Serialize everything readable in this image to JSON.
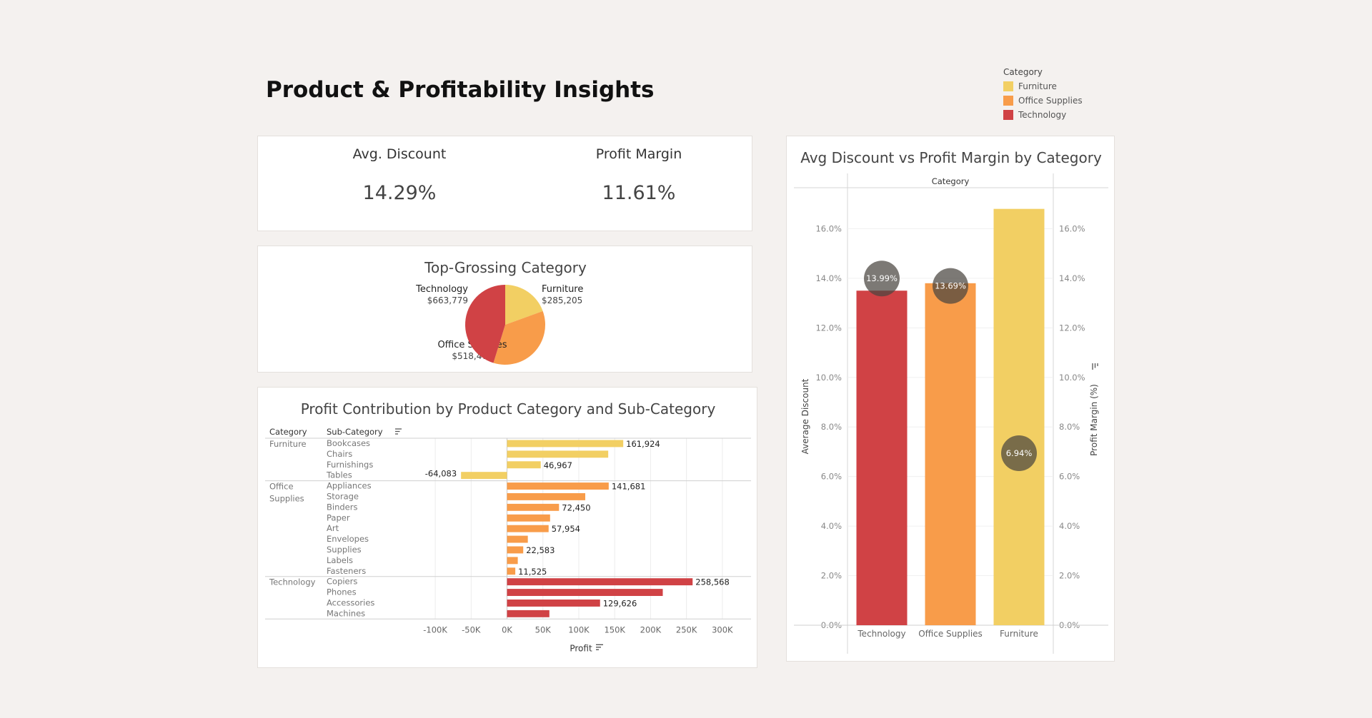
{
  "dashboard": {
    "title": "Product & Profitability Insights"
  },
  "colors": {
    "furniture": "#f2cf63",
    "office_supplies": "#f89c4a",
    "technology": "#d04245",
    "circle": "#5c5550"
  },
  "legend": {
    "title": "Category",
    "items": [
      {
        "label": "Furniture",
        "color": "#f2cf63"
      },
      {
        "label": "Office Supplies",
        "color": "#f89c4a"
      },
      {
        "label": "Technology",
        "color": "#d04245"
      }
    ]
  },
  "kpis": [
    {
      "label": "Avg. Discount",
      "value": "14.29%"
    },
    {
      "label": "Profit Margin",
      "value": "11.61%"
    }
  ],
  "chart_data": [
    {
      "type": "pie",
      "title": "Top-Grossing Category",
      "slices": [
        {
          "label": "Furniture",
          "value": 285205,
          "value_label": "$285,205",
          "color": "#f2cf63"
        },
        {
          "label": "Office Supplies",
          "value": 518474,
          "value_label": "$518,474",
          "color": "#f89c4a"
        },
        {
          "label": "Technology",
          "value": 663779,
          "value_label": "$663,779",
          "color": "#d04245"
        }
      ]
    },
    {
      "type": "bar",
      "orientation": "horizontal",
      "title": "Profit Contribution by Product Category and Sub-Category",
      "row_headers": [
        "Category",
        "Sub-Category"
      ],
      "xlabel": "Profit",
      "xlim": [
        -120000,
        330000
      ],
      "xticks": [
        -100000,
        -50000,
        0,
        50000,
        100000,
        150000,
        200000,
        250000,
        300000
      ],
      "xtick_labels": [
        "-100K",
        "-50K",
        "0K",
        "50K",
        "100K",
        "150K",
        "200K",
        "250K",
        "300K"
      ],
      "groups": [
        {
          "category": "Furniture",
          "color": "#f2cf63",
          "rows": [
            {
              "name": "Bookcases",
              "value": 161924,
              "label": "161,924"
            },
            {
              "name": "Chairs",
              "value": 141000,
              "label": ""
            },
            {
              "name": "Furnishings",
              "value": 46967,
              "label": "46,967"
            },
            {
              "name": "Tables",
              "value": -64083,
              "label": "-64,083"
            }
          ]
        },
        {
          "category": "Office Supplies",
          "color": "#f89c4a",
          "rows": [
            {
              "name": "Appliances",
              "value": 141681,
              "label": "141,681"
            },
            {
              "name": "Storage",
              "value": 109000,
              "label": ""
            },
            {
              "name": "Binders",
              "value": 72450,
              "label": "72,450"
            },
            {
              "name": "Paper",
              "value": 60000,
              "label": ""
            },
            {
              "name": "Art",
              "value": 57954,
              "label": "57,954"
            },
            {
              "name": "Envelopes",
              "value": 29000,
              "label": ""
            },
            {
              "name": "Supplies",
              "value": 22583,
              "label": "22,583"
            },
            {
              "name": "Labels",
              "value": 15000,
              "label": ""
            },
            {
              "name": "Fasteners",
              "value": 11525,
              "label": "11,525"
            }
          ]
        },
        {
          "category": "Technology",
          "color": "#d04245",
          "rows": [
            {
              "name": "Copiers",
              "value": 258568,
              "label": "258,568"
            },
            {
              "name": "Phones",
              "value": 217000,
              "label": ""
            },
            {
              "name": "Accessories",
              "value": 129626,
              "label": "129,626"
            },
            {
              "name": "Machines",
              "value": 59000,
              "label": ""
            }
          ]
        }
      ]
    },
    {
      "type": "bar",
      "title": "Avg Discount vs Profit Margin by Category",
      "header": "Category",
      "categories": [
        "Technology",
        "Office Supplies",
        "Furniture"
      ],
      "colors": [
        "#d04245",
        "#f89c4a",
        "#f2cf63"
      ],
      "ylabel": "Average Discount",
      "y2label": "Profit Margin (%)",
      "ylim": [
        0,
        18
      ],
      "yticks": [
        0,
        2,
        4,
        6,
        8,
        10,
        12,
        14,
        16
      ],
      "ytick_labels": [
        "0.0%",
        "2.0%",
        "4.0%",
        "6.0%",
        "8.0%",
        "10.0%",
        "12.0%",
        "14.0%",
        "16.0%"
      ],
      "bars": [
        13.5,
        13.8,
        16.8
      ],
      "margins": [
        13.99,
        13.69,
        6.94
      ],
      "margin_labels": [
        "13.99%",
        "13.69%",
        "6.94%"
      ]
    }
  ]
}
